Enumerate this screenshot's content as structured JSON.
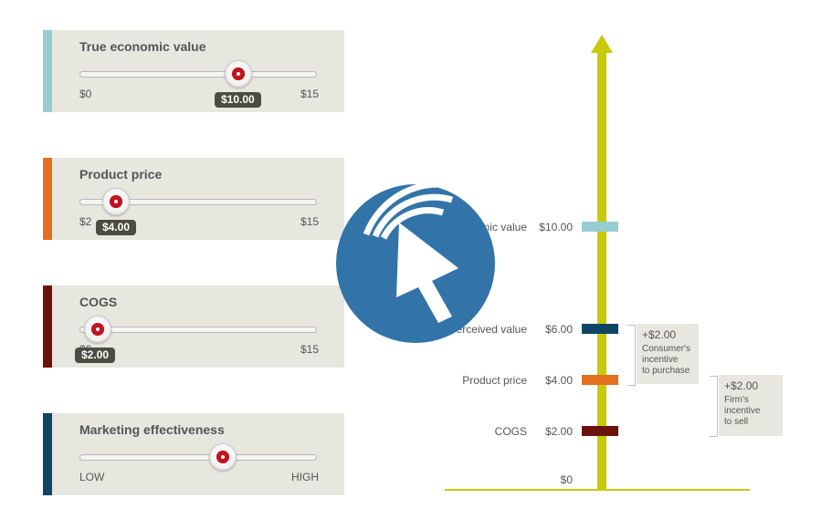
{
  "sliders": [
    {
      "title": "True economic value",
      "min_label": "$0",
      "max_label": "$15",
      "badge": "$10.00",
      "position": 0.667,
      "color": "#97cdd0"
    },
    {
      "title": "Product price",
      "min_label": "$2",
      "max_label": "$15",
      "badge": "$4.00",
      "position": 0.154,
      "color": "#e2701e"
    },
    {
      "title": "COGS",
      "min_label": "$0",
      "max_label": "$15",
      "badge": "$2.00",
      "position": 0.067,
      "color": "#6a130b"
    },
    {
      "title": "Marketing effectiveness",
      "min_label": "LOW",
      "max_label": "HIGH",
      "badge": "",
      "position": 0.6,
      "color": "#0e4566"
    }
  ],
  "chart": {
    "zero_label": "$0",
    "rows": [
      {
        "label": "True economic value",
        "value": "$10.00",
        "color": "#97cdd0"
      },
      {
        "label": "Perceived value",
        "value": "$6.00",
        "color": "#0e4566"
      },
      {
        "label": "Product price",
        "value": "$4.00",
        "color": "#e2701e"
      },
      {
        "label": "COGS",
        "value": "$2.00",
        "color": "#6a130b"
      }
    ],
    "notes": [
      {
        "amount": "+$2.00",
        "text1": "Consumer's",
        "text2": "incentive",
        "text3": "to purchase"
      },
      {
        "amount": "+$2.00",
        "text1": "Firm's",
        "text2": "incentive",
        "text3": "to sell"
      }
    ],
    "axis_color": "#c8c90a"
  },
  "overlay": {
    "icon": "play-cursor-icon",
    "color": "#3274a8"
  }
}
